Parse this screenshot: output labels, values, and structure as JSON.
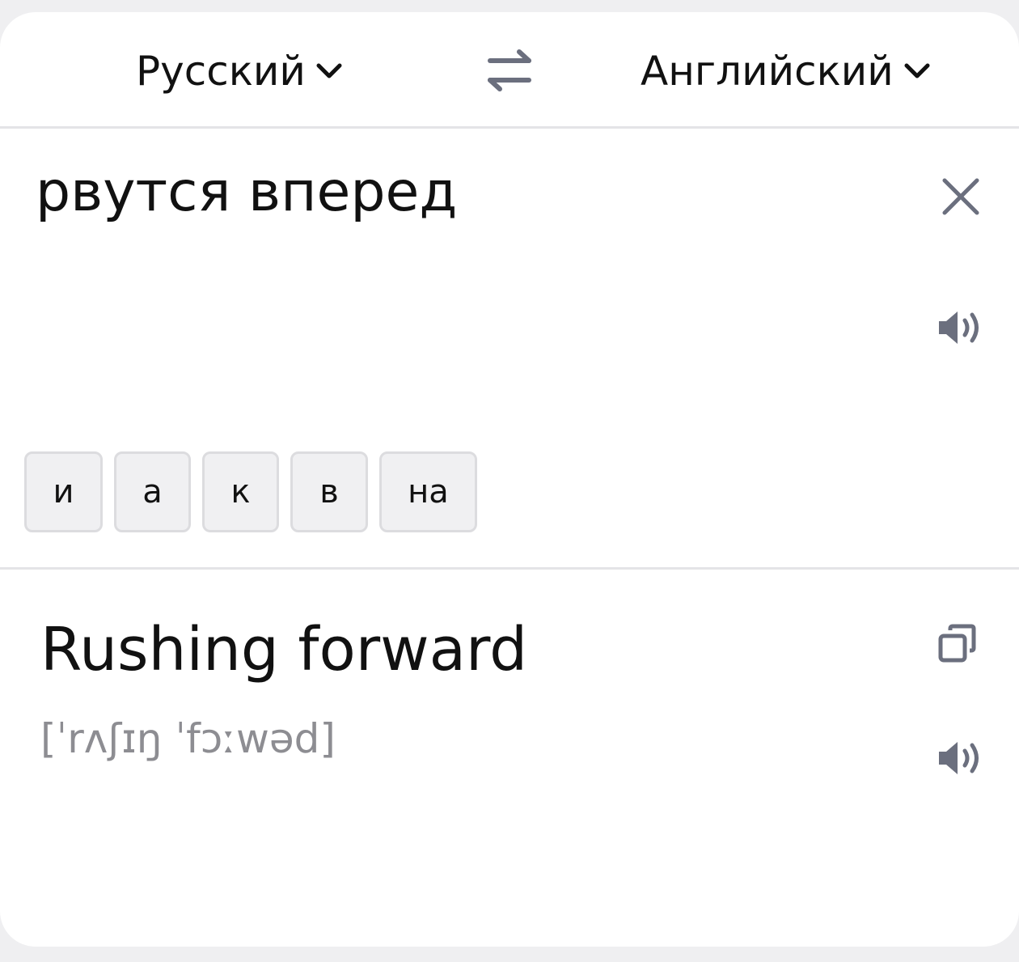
{
  "languages": {
    "source": "Русский",
    "target": "Английский"
  },
  "icons": {
    "source_chevron": "chevron-down-icon",
    "target_chevron": "chevron-down-icon",
    "swap": "swap-arrows-icon",
    "clear": "close-icon",
    "speaker": "speaker-icon",
    "copy": "copy-icon"
  },
  "source": {
    "text": "рвутся вперед"
  },
  "suggestions": [
    "и",
    "а",
    "к",
    "в",
    "на"
  ],
  "result": {
    "text": "Rushing forward",
    "transcription": "[ˈrʌʃɪŋ ˈfɔːwəd]"
  },
  "colors": {
    "icon": "#6b6f7e",
    "transcription": "#8d8d92",
    "divider": "#e4e4e7",
    "chip_bg": "#f0f0f2"
  }
}
